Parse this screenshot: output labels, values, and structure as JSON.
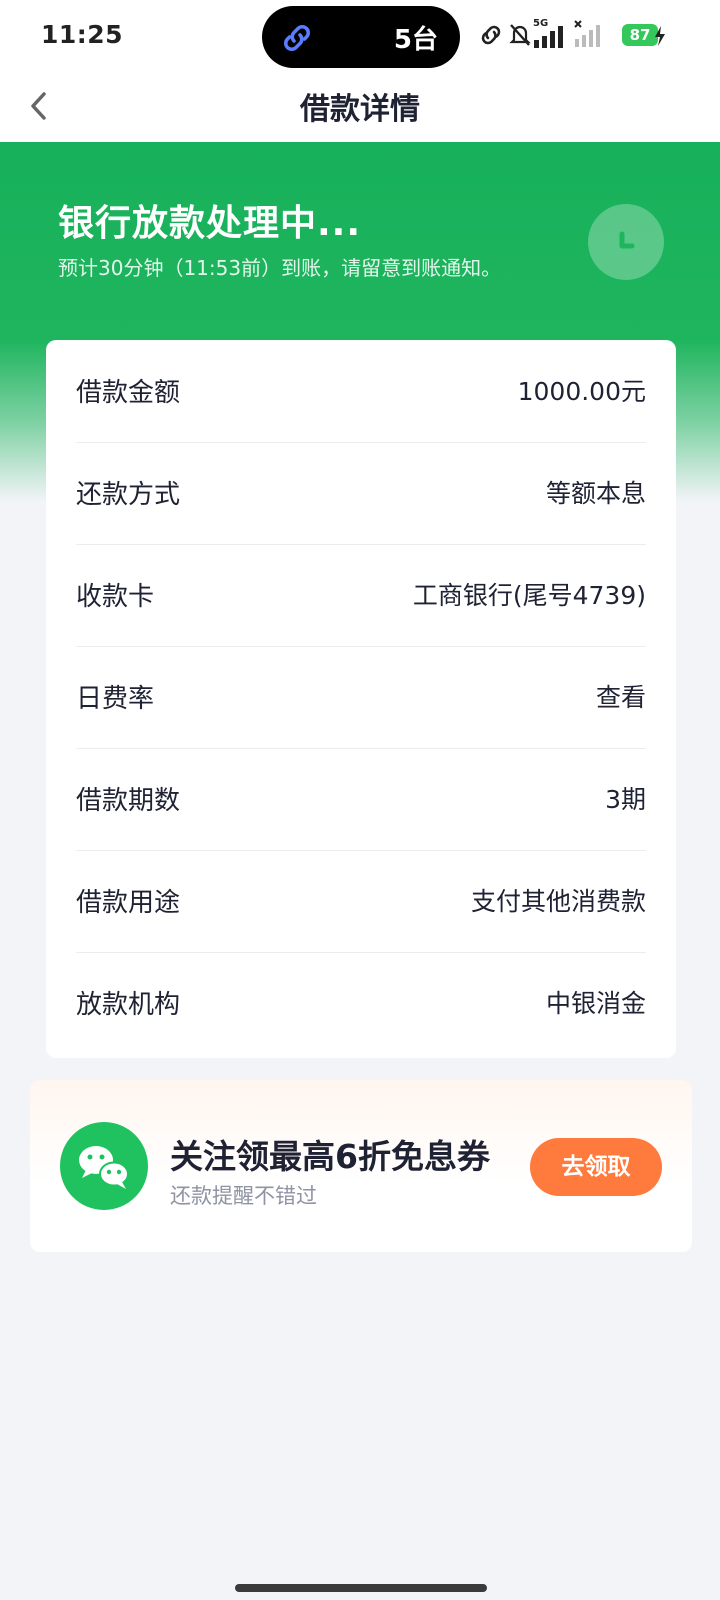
{
  "status_bar": {
    "time": "11:25",
    "island_text": "5台",
    "network_label": "5G",
    "battery": "87"
  },
  "nav": {
    "title": "借款详情",
    "back_icon": "chevron-left-icon"
  },
  "hero": {
    "title": "银行放款处理中...",
    "subtitle": "预计30分钟（11:53前）到账，请留意到账通知。",
    "icon": "clock-icon"
  },
  "details": {
    "rows": [
      {
        "label": "借款金额",
        "value": "1000.00元"
      },
      {
        "label": "还款方式",
        "value": "等额本息"
      },
      {
        "label": "收款卡",
        "value": "工商银行(尾号4739)"
      },
      {
        "label": "日费率",
        "value": "查看"
      },
      {
        "label": "借款期数",
        "value": "3期"
      },
      {
        "label": "借款用途",
        "value": "支付其他消费款"
      },
      {
        "label": "放款机构",
        "value": "中银消金"
      }
    ]
  },
  "promo": {
    "title": "关注领最高6折免息券",
    "subtitle": "还款提醒不错过",
    "button": "去领取",
    "icon": "wechat-icon"
  },
  "colors": {
    "brand_green": "#1fb55e",
    "button_orange": "#ff7a3d",
    "battery_green": "#34c759"
  }
}
